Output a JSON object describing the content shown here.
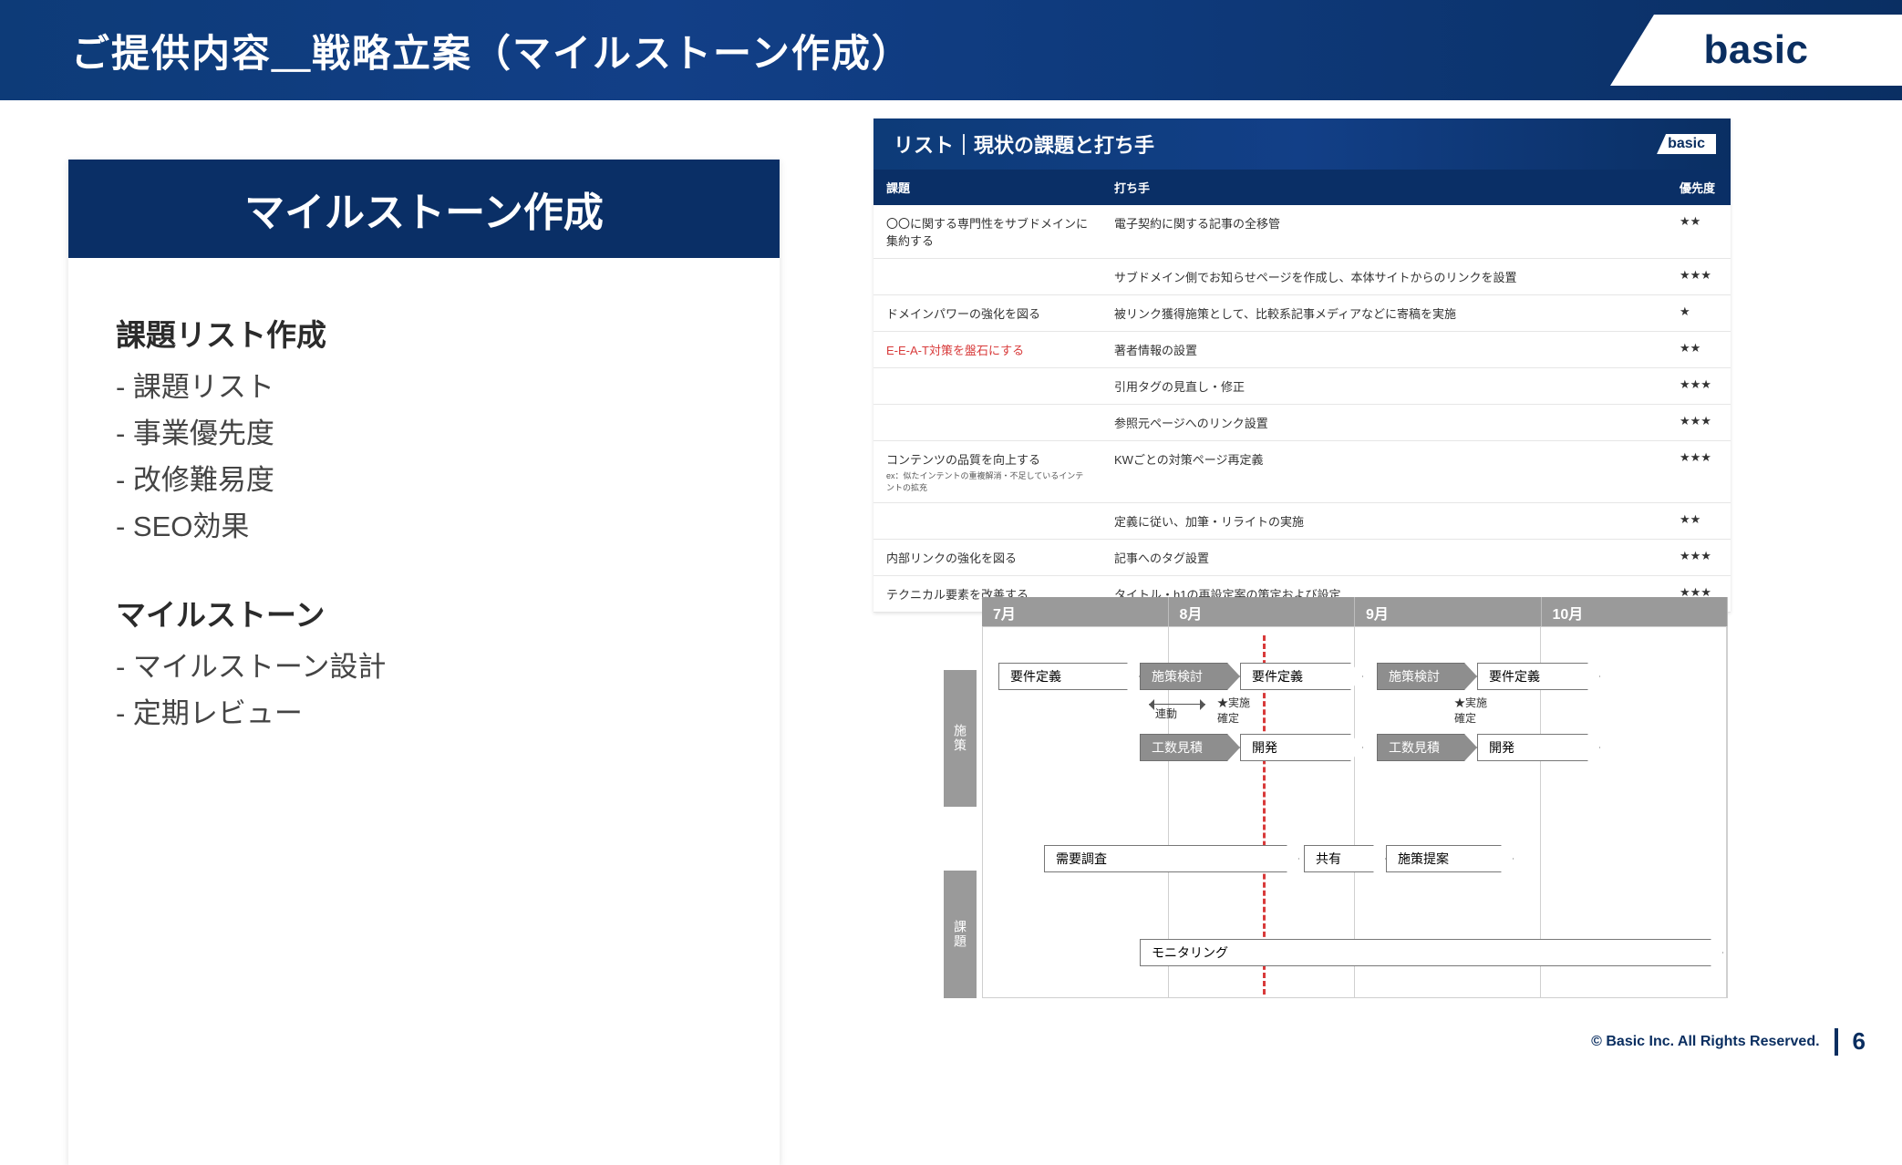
{
  "header": {
    "title": "ご提供内容＿戦略立案（マイルストーン作成）",
    "brand": "basic"
  },
  "left_card": {
    "title": "マイルストーン作成",
    "section1_title": "課題リスト作成",
    "section1_items": [
      "- 課題リスト",
      "- 事業優先度",
      "- 改修難易度",
      "- SEO効果"
    ],
    "section2_title": "マイルストーン",
    "section2_items": [
      "- マイルストーン設計",
      "- 定期レビュー"
    ]
  },
  "sub_slide": {
    "title": "リスト｜現状の課題と打ち手",
    "brand": "basic",
    "columns": [
      "課題",
      "打ち手",
      "優先度"
    ],
    "rows": [
      {
        "issue": "〇〇に関する専門性をサブドメインに集約する",
        "note": "",
        "action": "電子契約に関する記事の全移管",
        "priority": "★★"
      },
      {
        "issue": "",
        "note": "",
        "action": "サブドメイン側でお知らせページを作成し、本体サイトからのリンクを設置",
        "priority": "★★★"
      },
      {
        "issue": "ドメインパワーの強化を図る",
        "note": "",
        "action": "被リンク獲得施策として、比較系記事メディアなどに寄稿を実施",
        "priority": "★"
      },
      {
        "issue": "E-E-A-T対策を盤石にする",
        "note": "",
        "action": "著者情報の設置",
        "priority": "★★",
        "issue_red": true
      },
      {
        "issue": "",
        "note": "",
        "action": "引用タグの見直し・修正",
        "priority": "★★★"
      },
      {
        "issue": "",
        "note": "",
        "action": "参照元ページへのリンク設置",
        "priority": "★★★"
      },
      {
        "issue": "コンテンツの品質を向上する",
        "note": "ex：似たインテントの重複解消・不足しているインテントの拡充",
        "action": "KWごとの対策ページ再定義",
        "priority": "★★★"
      },
      {
        "issue": "",
        "note": "",
        "action": "定義に従い、加筆・リライトの実施",
        "priority": "★★"
      },
      {
        "issue": "内部リンクの強化を図る",
        "note": "",
        "action": "記事へのタグ設置",
        "priority": "★★★"
      },
      {
        "issue": "テクニカル要素を改善する",
        "note": "",
        "action": "タイトル・h1の再設定案の策定および設定",
        "priority": "★★★"
      }
    ]
  },
  "gantt": {
    "months": [
      "7月",
      "8月",
      "9月",
      "10月"
    ],
    "side_labels": {
      "top": "施策",
      "bottom": "課題"
    },
    "top_group": {
      "row1": [
        "要件定義",
        "施策検討",
        "要件定義",
        "施策検討",
        "要件定義"
      ],
      "link_label": "連動",
      "star_label": "★実施\n確定",
      "row2": [
        "工数見積",
        "開発",
        "工数見積",
        "開発"
      ]
    },
    "bottom_group": {
      "row1": [
        "需要調査",
        "共有",
        "施策提案"
      ],
      "row2": [
        "モニタリング"
      ]
    }
  },
  "footer": {
    "copyright": "© Basic Inc. All Rights Reserved.",
    "page": "6"
  }
}
